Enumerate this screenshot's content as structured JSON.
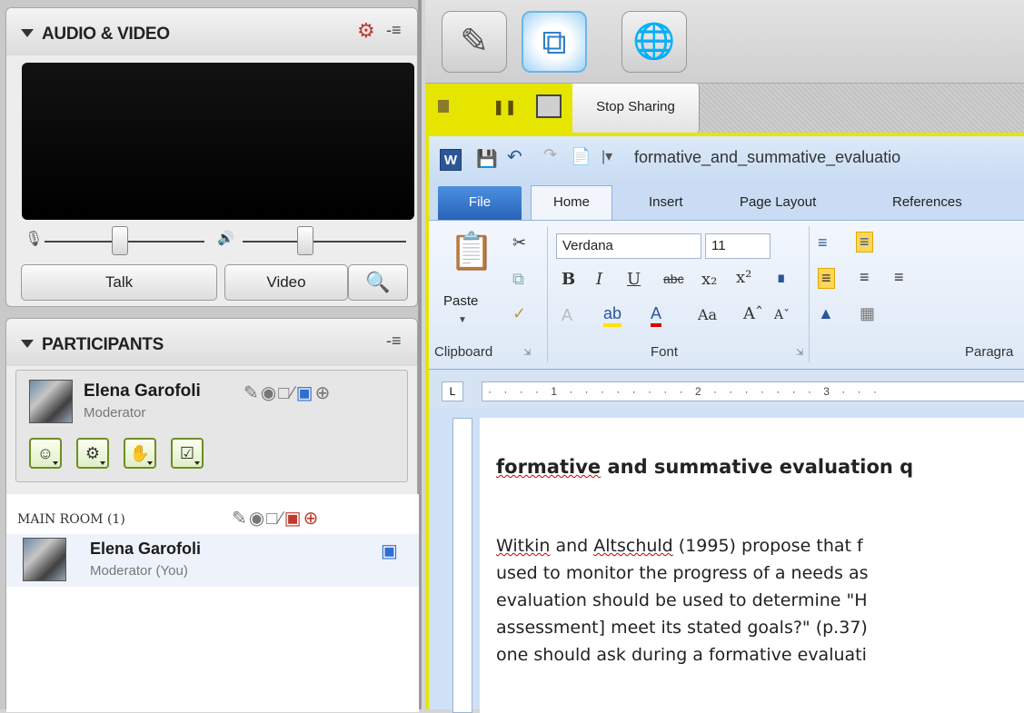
{
  "audio_video": {
    "title": "AUDIO & VIDEO",
    "menu_glyph": "-≡",
    "talk_label": "Talk",
    "video_label": "Video"
  },
  "participants": {
    "title": "PARTICIPANTS",
    "menu_glyph": "-≡",
    "current_user": {
      "name": "Elena Garofoli",
      "role": "Moderator"
    },
    "main_room": {
      "label": "MAIN ROOM (1)",
      "members": [
        {
          "name": "Elena Garofoli",
          "role": "Moderator (You)"
        }
      ]
    }
  },
  "share_bar": {
    "stop_sharing_label": "Stop Sharing"
  },
  "word": {
    "logo": "W",
    "title": "formative_and_summative_evaluatio",
    "tabs": {
      "file": "File",
      "home": "Home",
      "insert": "Insert",
      "page_layout": "Page Layout",
      "references": "References"
    },
    "ribbon": {
      "paste_label": "Paste",
      "font_name": "Verdana",
      "font_size": "11",
      "clipboard_group": "Clipboard",
      "font_group": "Font",
      "paragraph_group": "Paragra"
    },
    "ruler_text": "· · · · 1 · · · · · · · · 2 · · · · · · · 3 · · ·"
  },
  "document": {
    "title_word": "formative",
    "title_rest": " and summative evaluation q",
    "line1_a": "Witkin",
    "line1_b": " and ",
    "line1_c": "Altschuld",
    "line1_d": " (1995) propose that f",
    "line2": "used to monitor the progress of a needs as",
    "line3": "evaluation should be used to determine \"H",
    "line4": "assessment] meet its stated goals?\" (p.37)",
    "line5": "one should ask during a formative evaluati"
  },
  "colors": {
    "share_highlight": "#e5e500",
    "file_tab": "#2a63b8",
    "status_border": "#6b8e23"
  },
  "icons": [
    "triangle-down-icon",
    "settings-icon",
    "menu-icon",
    "microphone-icon",
    "speaker-icon",
    "camera-search-icon",
    "whiteboard-icon",
    "share-screen-icon",
    "web-tour-icon",
    "word-app-icon",
    "save-icon",
    "undo-icon",
    "paste-icon",
    "cut-icon",
    "copy-icon",
    "format-painter-icon"
  ]
}
